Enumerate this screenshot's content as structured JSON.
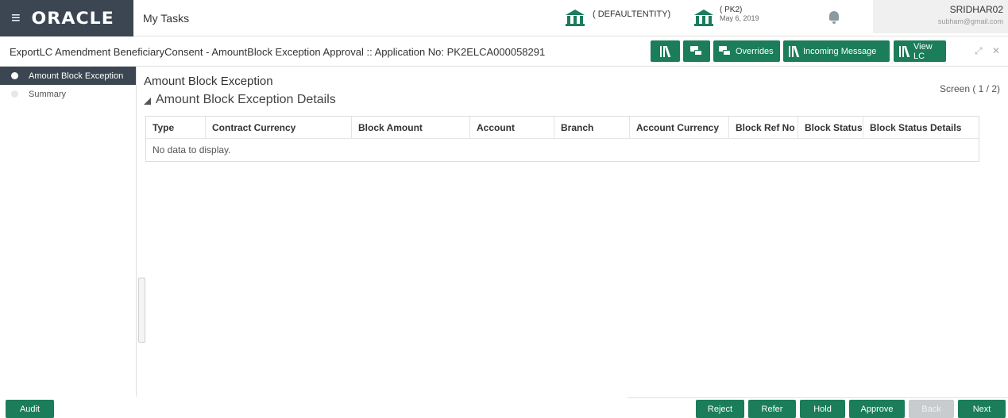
{
  "header": {
    "logo": "ORACLE",
    "app_name": "My Tasks",
    "entity": "( DEFAULTENTITY)",
    "branch_code": "( PK2)",
    "branch_date": "May 6, 2019",
    "user_name": "SRIDHAR02",
    "user_email": "subham@gmail.com"
  },
  "titlebar": {
    "title": "ExportLC Amendment BeneficiaryConsent - AmountBlock Exception Approval :: Application No: PK2ELCA000058291",
    "buttons": {
      "overrides": "Overrides",
      "incoming_message": "Incoming Message",
      "view_lc": "View LC"
    }
  },
  "sidebar": {
    "items": [
      {
        "label": "Amount Block Exception",
        "active": true
      },
      {
        "label": "Summary",
        "active": false
      }
    ]
  },
  "main": {
    "section_title": "Amount Block Exception",
    "screen_indicator": "Screen ( 1 / 2)",
    "subsection_title": "Amount Block Exception Details",
    "table": {
      "columns": [
        "Type",
        "Contract Currency",
        "Block Amount",
        "Account",
        "Branch",
        "Account Currency",
        "Block Ref No",
        "Block Status",
        "Block Status Details"
      ],
      "empty_message": "No data to display."
    }
  },
  "footer": {
    "audit": "Audit",
    "reject": "Reject",
    "refer": "Refer",
    "hold": "Hold",
    "approve": "Approve",
    "back": "Back",
    "next": "Next"
  },
  "colors": {
    "brand_dark": "#3b4652",
    "accent_green": "#1b7d5a",
    "disabled": "#c9ccce"
  }
}
